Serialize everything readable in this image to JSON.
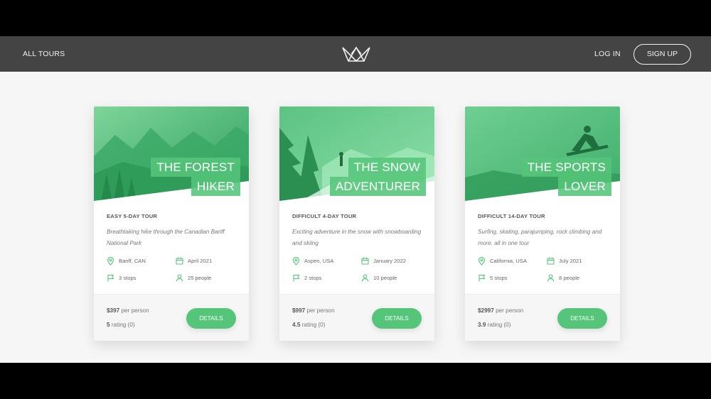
{
  "nav": {
    "all_tours": "All tours",
    "login": "Log in",
    "signup": "Sign up"
  },
  "colors": {
    "accent": "#55c57a",
    "nav_bg": "#444444",
    "page_bg": "#f6f6f6"
  },
  "cards": [
    {
      "title_line1": "The Forest",
      "title_line2": "Hiker",
      "subtitle": "Easy 5-day tour",
      "description": "Breathtaking hike through the Canadian Banff National Park",
      "location": "Banff, CAN",
      "date": "April 2021",
      "stops": "3 stops",
      "people": "25 people",
      "price": "$397",
      "price_suffix": "per person",
      "rating_value": "5",
      "rating_suffix": "rating (0)",
      "button": "Details"
    },
    {
      "title_line1": "The Snow",
      "title_line2": "Adventurer",
      "subtitle": "Difficult 4-day tour",
      "description": "Exciting adventure in the snow with snowboarding and skiing",
      "location": "Aspen, USA",
      "date": "January 2022",
      "stops": "2 stops",
      "people": "10 people",
      "price": "$997",
      "price_suffix": "per person",
      "rating_value": "4.5",
      "rating_suffix": "rating (0)",
      "button": "Details"
    },
    {
      "title_line1": "The Sports",
      "title_line2": "Lover",
      "subtitle": "Difficult 14-day tour",
      "description": "Surfing, skating, parajumping, rock climbing and more, all in one tour",
      "location": "California, USA",
      "date": "July 2021",
      "stops": "5 stops",
      "people": "8 people",
      "price": "$2997",
      "price_suffix": "per person",
      "rating_value": "3.9",
      "rating_suffix": "rating (0)",
      "button": "Details"
    }
  ]
}
